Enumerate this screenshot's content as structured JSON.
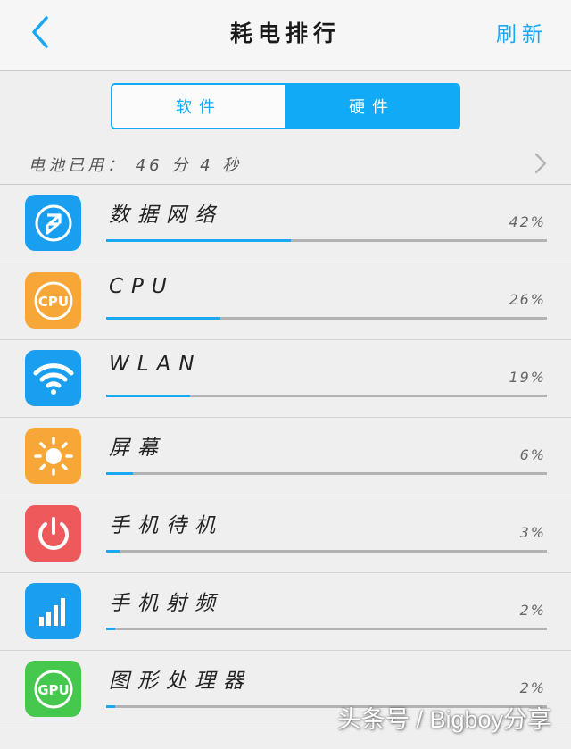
{
  "header": {
    "title": "耗电排行",
    "refresh_label": "刷新"
  },
  "tabs": [
    {
      "label": "软件",
      "active": false
    },
    {
      "label": "硬件",
      "active": true
    }
  ],
  "battery_used": "电池已用： 46 分 4 秒",
  "items": [
    {
      "name": "数据网络",
      "percent": "42%",
      "fraction": 0.42,
      "icon": "data-network-icon",
      "color": "#1a9ff0"
    },
    {
      "name": "CPU",
      "percent": "26%",
      "fraction": 0.26,
      "icon": "cpu-icon",
      "color": "#f7a737"
    },
    {
      "name": "WLAN",
      "percent": "19%",
      "fraction": 0.19,
      "icon": "wifi-icon",
      "color": "#1a9ff0"
    },
    {
      "name": "屏幕",
      "percent": "6%",
      "fraction": 0.06,
      "icon": "brightness-icon",
      "color": "#f7a737"
    },
    {
      "name": "手机待机",
      "percent": "3%",
      "fraction": 0.03,
      "icon": "power-icon",
      "color": "#ee5a5c"
    },
    {
      "name": "手机射频",
      "percent": "2%",
      "fraction": 0.02,
      "icon": "signal-icon",
      "color": "#1a9ff0"
    },
    {
      "name": "图形处理器",
      "percent": "2%",
      "fraction": 0.02,
      "icon": "gpu-icon",
      "color": "#46c84e"
    }
  ],
  "icon_labels": {
    "cpu": "CPU",
    "gpu": "GPU"
  },
  "watermark": "头条号 / Bigboy分享",
  "accent_color": "#11aaf6"
}
